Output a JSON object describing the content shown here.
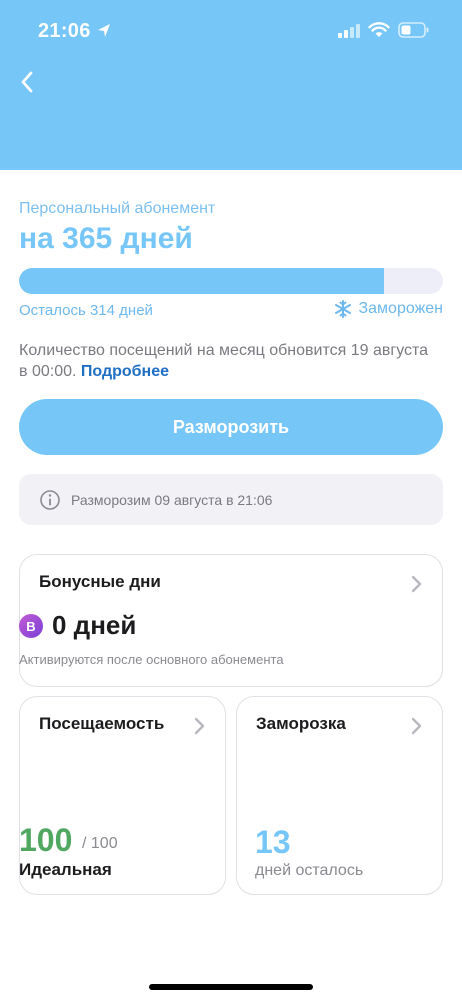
{
  "status_bar": {
    "time": "21:06"
  },
  "colors": {
    "header_bg": "#76c6f7",
    "accent": "#76c6f7",
    "link": "#1f6fc4",
    "success": "#4fa760"
  },
  "subscription": {
    "type_label": "Персональный абонемент",
    "duration_label": "на 365 дней",
    "remaining_label": "Осталось 314 дней",
    "status_label": "Заморожен",
    "status_icon": "snowflake-icon",
    "progress_fraction": 0.86
  },
  "visits_note": {
    "text": "Количество посещений на месяц обновится 19 августа в 00:00.",
    "link": "Подробнее"
  },
  "actions": {
    "unfreeze_label": "Разморозить"
  },
  "info": {
    "text": "Разморозим 09 августа в 21:06",
    "icon": "info-icon"
  },
  "bonus": {
    "title": "Бонусные дни",
    "coin_letter": "B",
    "value": "0 дней",
    "note": "Активируются после основного абонемента"
  },
  "attendance": {
    "title": "Посещаемость",
    "score": "100",
    "max": "/ 100",
    "label": "Идеальная"
  },
  "freeze": {
    "title": "Заморозка",
    "days": "13",
    "label": "дней осталось"
  }
}
